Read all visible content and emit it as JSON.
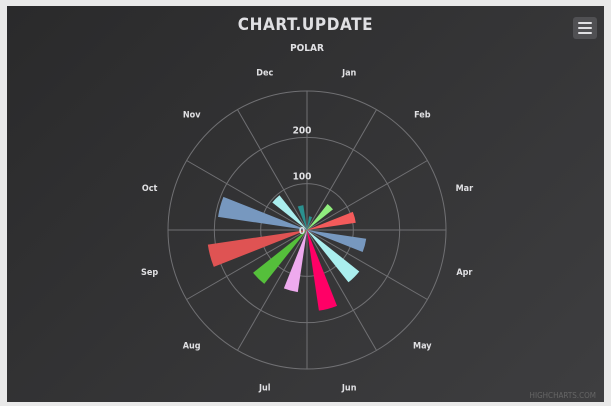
{
  "chart_data": {
    "type": "bar",
    "polar": true,
    "title": "CHART.UPDATE",
    "subtitle": "POLAR",
    "categories": [
      "Jan",
      "Feb",
      "Mar",
      "Apr",
      "May",
      "Jun",
      "Jul",
      "Aug",
      "Sep",
      "Oct",
      "Nov",
      "Dec"
    ],
    "values": [
      29.9,
      71.5,
      106.4,
      129.2,
      144.0,
      176.0,
      135.6,
      148.5,
      216.4,
      194.1,
      95.6,
      54.4
    ],
    "colors": [
      "#2b908f",
      "#90ee7e",
      "#f45b5b",
      "#7798bf",
      "#aaeeee",
      "#ff0066",
      "#eeaaee",
      "#55bf3b",
      "#df5353",
      "#7798bf",
      "#aaeeee",
      "#2b908f"
    ],
    "yaxis_ticks": [
      0,
      100,
      200
    ],
    "ylim": [
      0,
      300
    ],
    "grid": true,
    "legend": false,
    "credits": "HIGHCHARTS.COM"
  },
  "colors": {
    "background_start": "#2a2a2b",
    "background_end": "#3e3e40",
    "text": "#e0e0e3",
    "grid": "#707073"
  },
  "menu_icon": "hamburger-menu-icon"
}
